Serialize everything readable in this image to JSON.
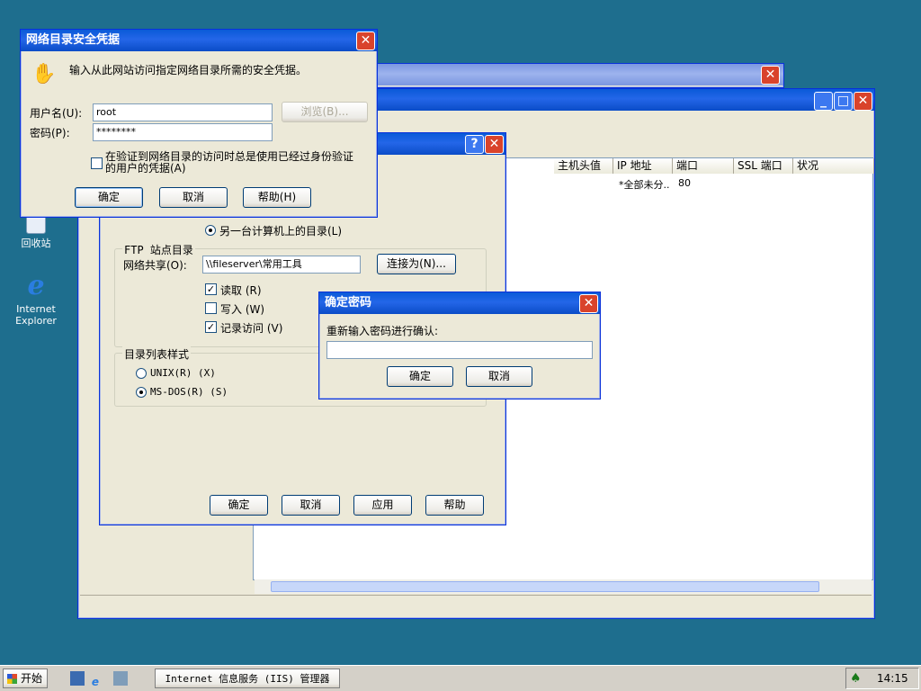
{
  "desktop": {
    "icons": [
      {
        "label": "回收站",
        "name": "recycle-bin-icon"
      },
      {
        "label": "Internet\nExplorer",
        "name": "internet-explorer-icon"
      }
    ]
  },
  "iis_window": {
    "columns": [
      "主机头值",
      "IP 地址",
      "端口",
      "SSL 端口",
      "状况"
    ],
    "row": {
      "ip": "*全部未分..",
      "port": "80"
    }
  },
  "properties_dialog": {
    "radio_other_computer": "另一台计算机上的目录(L)",
    "ftp_group": "FTP 站点目录",
    "share_label": "网络共享(O):",
    "share_value": "\\\\fileserver\\常用工具",
    "connect_as": "连接为(N)...",
    "read": "读取 (R)",
    "write": "写入 (W)",
    "log": "记录访问 (V)",
    "list_style_group": "目录列表样式",
    "unix": "UNIX(R) (X)",
    "msdos": "MS-DOS(R) (S)",
    "buttons": {
      "ok": "确定",
      "cancel": "取消",
      "apply": "应用",
      "help": "帮助"
    }
  },
  "credentials_dialog": {
    "title": "网络目录安全凭据",
    "description": "输入从此网站访问指定网络目录所需的安全凭据。",
    "username_label": "用户名(U):",
    "username_value": "root",
    "password_label": "密码(P):",
    "password_value": "********",
    "browse": "浏览(B)...",
    "checkbox": "在验证到网络目录的访问时总是使用已经过身份验证的用户的凭据(A)",
    "ok": "确定",
    "cancel": "取消",
    "help": "帮助(H)"
  },
  "confirm_dialog": {
    "title": "确定密码",
    "prompt": "重新输入密码进行确认:",
    "ok": "确定",
    "cancel": "取消"
  },
  "taskbar": {
    "start": "开始",
    "task": "Internet 信息服务 (IIS) 管理器",
    "time": "14:15"
  },
  "colors": {
    "desktop": "#1e6e8e",
    "titlebar": "#0a5ad8",
    "close": "#d9432b"
  }
}
